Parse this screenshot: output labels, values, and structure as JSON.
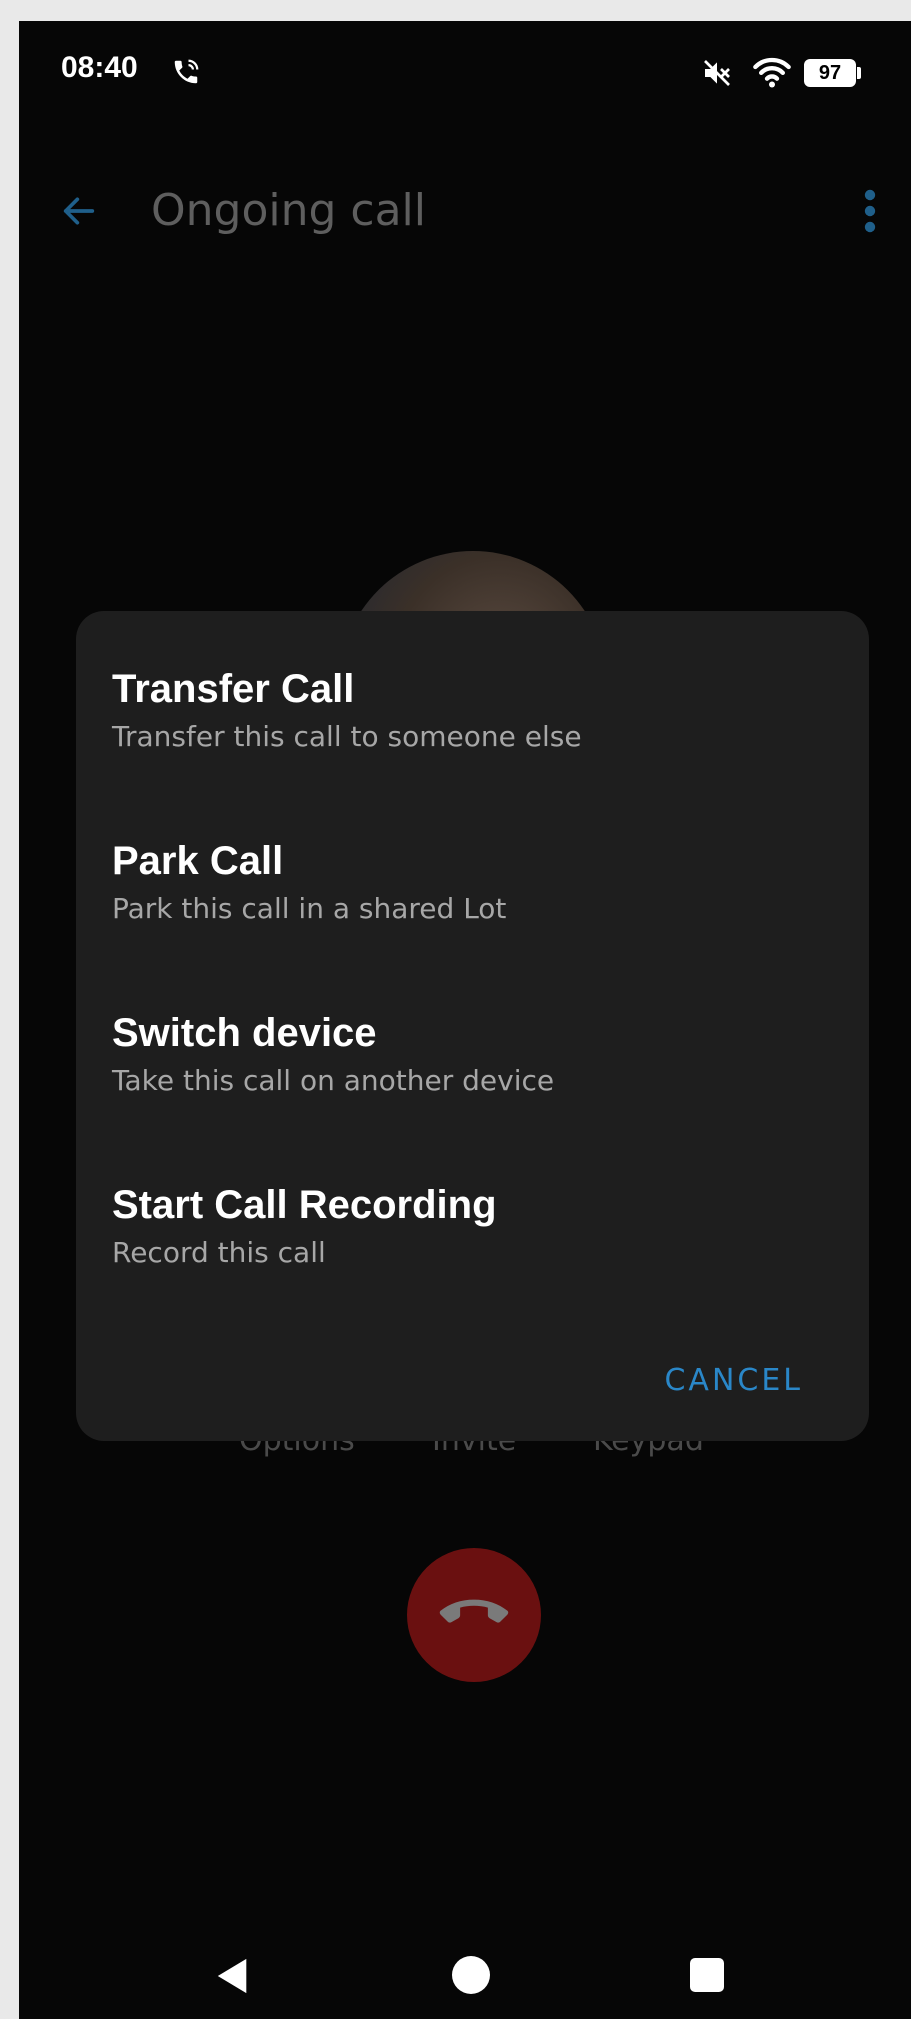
{
  "status_bar": {
    "time": "08:40",
    "battery": "97",
    "icons": [
      "phone-call-icon",
      "mute-icon",
      "wifi-icon",
      "battery-icon"
    ]
  },
  "app_bar": {
    "title": "Ongoing call",
    "back_icon": "arrow-left-icon",
    "menu_icon": "more-vert-icon",
    "accent_color": "#1f5f8a"
  },
  "background_actions": {
    "labels": [
      "Options",
      "Invite",
      "Keypad"
    ]
  },
  "dialog": {
    "items": [
      {
        "title": "Transfer Call",
        "subtitle": "Transfer this call to someone else"
      },
      {
        "title": "Park Call",
        "subtitle": "Park this call in a shared Lot"
      },
      {
        "title": "Switch device",
        "subtitle": "Take this call on another device"
      },
      {
        "title": "Start Call Recording",
        "subtitle": "Record this call"
      }
    ],
    "cancel_label": "CANCEL",
    "cancel_color": "#2a87c8"
  },
  "end_call": {
    "color": "#6a1010",
    "icon": "call-end-icon"
  },
  "nav_bar": {
    "icons": [
      "nav-back-icon",
      "nav-home-icon",
      "nav-recents-icon"
    ]
  }
}
